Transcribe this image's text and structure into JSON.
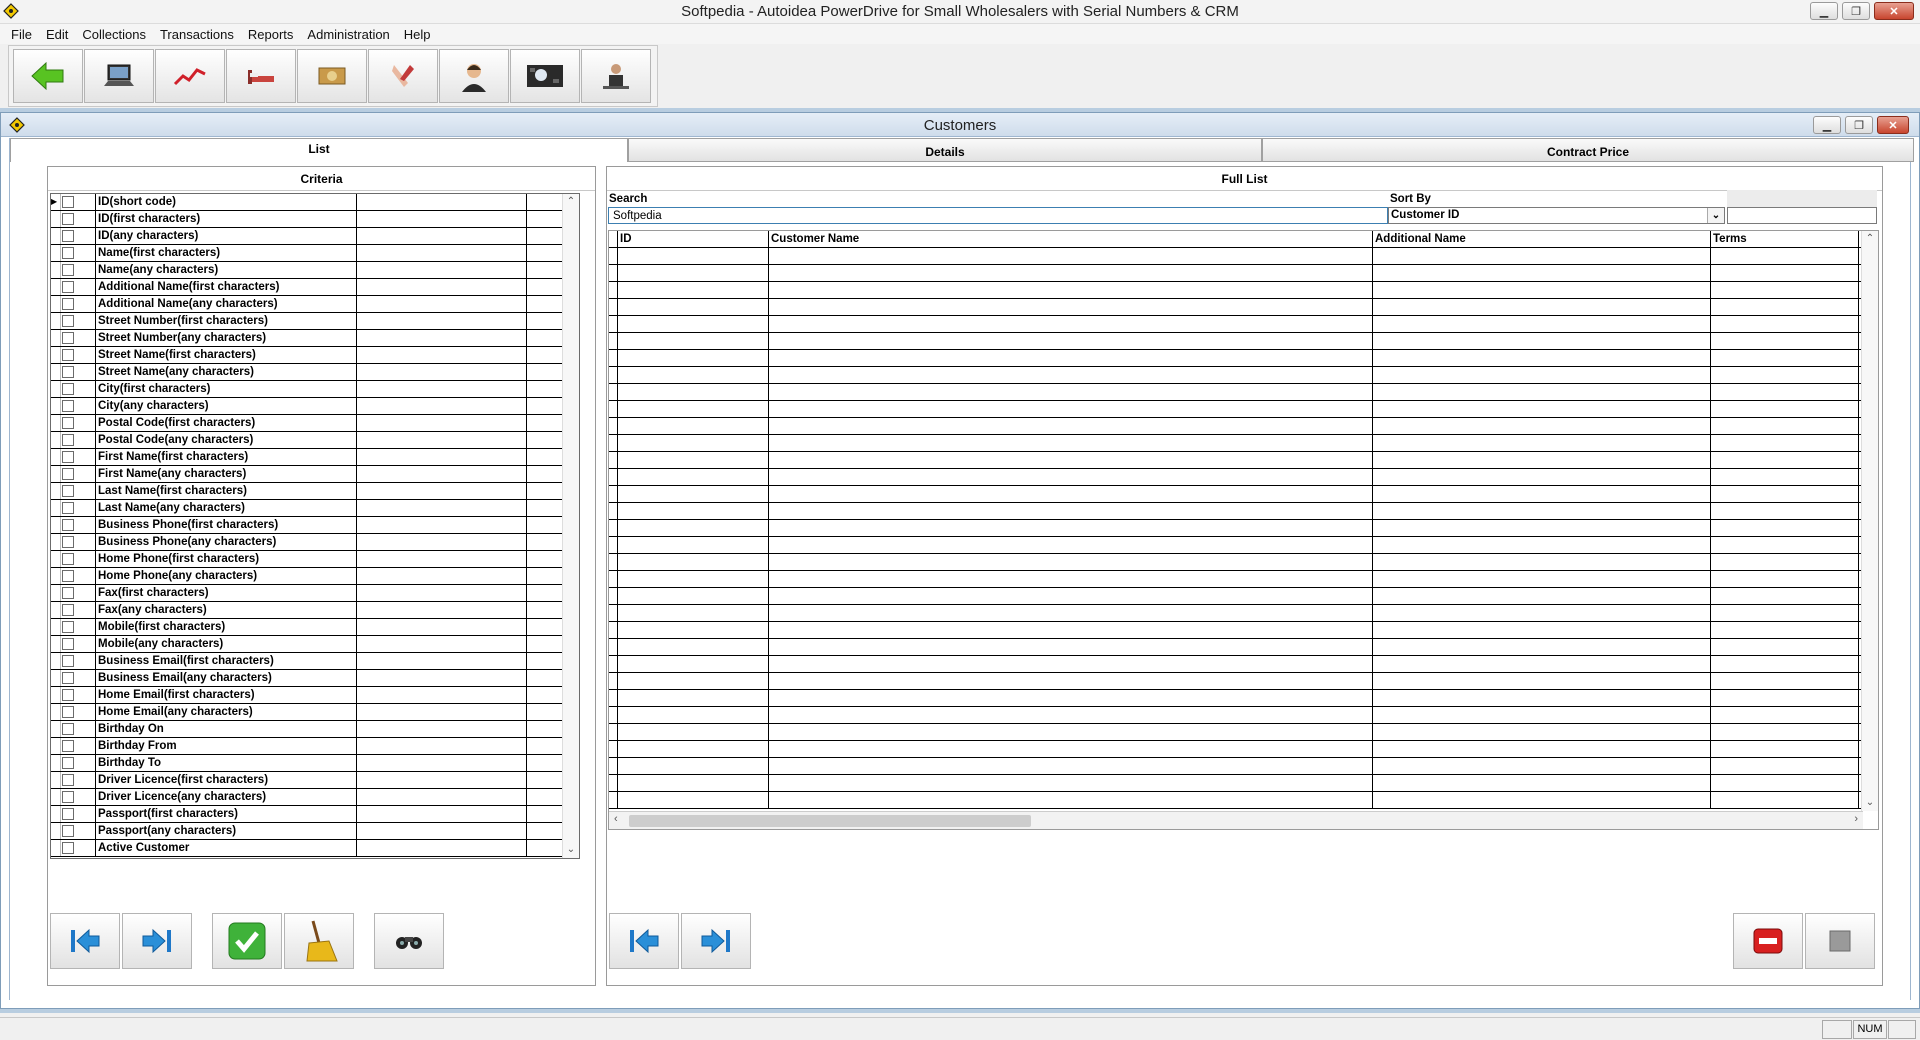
{
  "window": {
    "title": "Softpedia - Autoidea PowerDrive for Small Wholesalers with Serial Numbers & CRM"
  },
  "menu": [
    "File",
    "Edit",
    "Collections",
    "Transactions",
    "Reports",
    "Administration",
    "Help"
  ],
  "toolbar": [
    "back-arrow-icon",
    "laptop-icon",
    "chart-icon",
    "bed-icon",
    "money-icon",
    "handshake-icon",
    "support-agent-icon",
    "keyboard-icon",
    "businessman-icon"
  ],
  "child": {
    "title": "Customers"
  },
  "tabs": [
    {
      "label": "List",
      "active": true
    },
    {
      "label": "Details",
      "active": false
    },
    {
      "label": "Contract Price",
      "active": false
    }
  ],
  "criteria": {
    "title": "Criteria",
    "rows": [
      "ID(short code)",
      "ID(first characters)",
      "ID(any characters)",
      "Name(first characters)",
      "Name(any characters)",
      "Additional Name(first characters)",
      "Additional Name(any characters)",
      "Street Number(first characters)",
      "Street Number(any characters)",
      "Street Name(first characters)",
      "Street Name(any characters)",
      "City(first characters)",
      "City(any characters)",
      "Postal Code(first characters)",
      "Postal Code(any characters)",
      "First Name(first characters)",
      "First Name(any characters)",
      "Last Name(first characters)",
      "Last Name(any characters)",
      "Business Phone(first characters)",
      "Business Phone(any characters)",
      "Home Phone(first characters)",
      "Home Phone(any characters)",
      "Fax(first characters)",
      "Fax(any characters)",
      "Mobile(first characters)",
      "Mobile(any characters)",
      "Business Email(first characters)",
      "Business Email(any characters)",
      "Home Email(first characters)",
      "Home Email(any characters)",
      "Birthday On",
      "Birthday From",
      "Birthday To",
      "Driver Licence(first characters)",
      "Driver Licence(any characters)",
      "Passport(first characters)",
      "Passport(any characters)",
      "Active Customer"
    ]
  },
  "fulllist": {
    "title": "Full List",
    "search_label": "Search",
    "search_value": "Softpedia",
    "sort_label": "Sort By",
    "sort_value": "Customer ID",
    "columns": [
      "ID",
      "Customer Name",
      "Additional Name",
      "Terms"
    ]
  },
  "status": {
    "num": "NUM"
  },
  "colors": {
    "mdi_bg": "#b8cde0",
    "accent": "#3c7fb1"
  }
}
